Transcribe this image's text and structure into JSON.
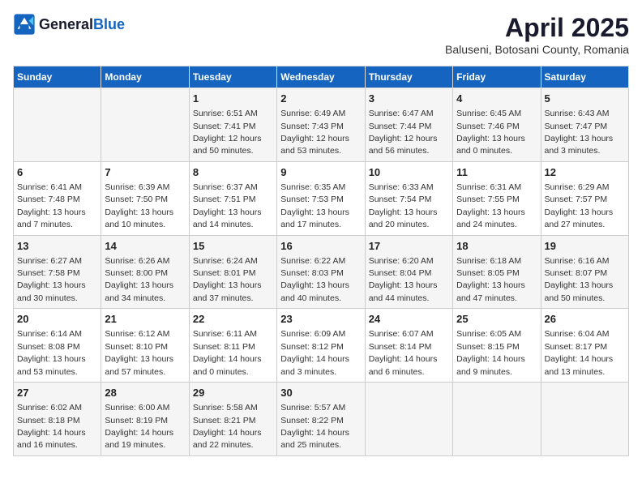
{
  "header": {
    "logo_general": "General",
    "logo_blue": "Blue",
    "title": "April 2025",
    "location": "Baluseni, Botosani County, Romania"
  },
  "days_of_week": [
    "Sunday",
    "Monday",
    "Tuesday",
    "Wednesday",
    "Thursday",
    "Friday",
    "Saturday"
  ],
  "weeks": [
    [
      {
        "day": "",
        "sunrise": "",
        "sunset": "",
        "daylight": ""
      },
      {
        "day": "",
        "sunrise": "",
        "sunset": "",
        "daylight": ""
      },
      {
        "day": "1",
        "sunrise": "Sunrise: 6:51 AM",
        "sunset": "Sunset: 7:41 PM",
        "daylight": "Daylight: 12 hours and 50 minutes."
      },
      {
        "day": "2",
        "sunrise": "Sunrise: 6:49 AM",
        "sunset": "Sunset: 7:43 PM",
        "daylight": "Daylight: 12 hours and 53 minutes."
      },
      {
        "day": "3",
        "sunrise": "Sunrise: 6:47 AM",
        "sunset": "Sunset: 7:44 PM",
        "daylight": "Daylight: 12 hours and 56 minutes."
      },
      {
        "day": "4",
        "sunrise": "Sunrise: 6:45 AM",
        "sunset": "Sunset: 7:46 PM",
        "daylight": "Daylight: 13 hours and 0 minutes."
      },
      {
        "day": "5",
        "sunrise": "Sunrise: 6:43 AM",
        "sunset": "Sunset: 7:47 PM",
        "daylight": "Daylight: 13 hours and 3 minutes."
      }
    ],
    [
      {
        "day": "6",
        "sunrise": "Sunrise: 6:41 AM",
        "sunset": "Sunset: 7:48 PM",
        "daylight": "Daylight: 13 hours and 7 minutes."
      },
      {
        "day": "7",
        "sunrise": "Sunrise: 6:39 AM",
        "sunset": "Sunset: 7:50 PM",
        "daylight": "Daylight: 13 hours and 10 minutes."
      },
      {
        "day": "8",
        "sunrise": "Sunrise: 6:37 AM",
        "sunset": "Sunset: 7:51 PM",
        "daylight": "Daylight: 13 hours and 14 minutes."
      },
      {
        "day": "9",
        "sunrise": "Sunrise: 6:35 AM",
        "sunset": "Sunset: 7:53 PM",
        "daylight": "Daylight: 13 hours and 17 minutes."
      },
      {
        "day": "10",
        "sunrise": "Sunrise: 6:33 AM",
        "sunset": "Sunset: 7:54 PM",
        "daylight": "Daylight: 13 hours and 20 minutes."
      },
      {
        "day": "11",
        "sunrise": "Sunrise: 6:31 AM",
        "sunset": "Sunset: 7:55 PM",
        "daylight": "Daylight: 13 hours and 24 minutes."
      },
      {
        "day": "12",
        "sunrise": "Sunrise: 6:29 AM",
        "sunset": "Sunset: 7:57 PM",
        "daylight": "Daylight: 13 hours and 27 minutes."
      }
    ],
    [
      {
        "day": "13",
        "sunrise": "Sunrise: 6:27 AM",
        "sunset": "Sunset: 7:58 PM",
        "daylight": "Daylight: 13 hours and 30 minutes."
      },
      {
        "day": "14",
        "sunrise": "Sunrise: 6:26 AM",
        "sunset": "Sunset: 8:00 PM",
        "daylight": "Daylight: 13 hours and 34 minutes."
      },
      {
        "day": "15",
        "sunrise": "Sunrise: 6:24 AM",
        "sunset": "Sunset: 8:01 PM",
        "daylight": "Daylight: 13 hours and 37 minutes."
      },
      {
        "day": "16",
        "sunrise": "Sunrise: 6:22 AM",
        "sunset": "Sunset: 8:03 PM",
        "daylight": "Daylight: 13 hours and 40 minutes."
      },
      {
        "day": "17",
        "sunrise": "Sunrise: 6:20 AM",
        "sunset": "Sunset: 8:04 PM",
        "daylight": "Daylight: 13 hours and 44 minutes."
      },
      {
        "day": "18",
        "sunrise": "Sunrise: 6:18 AM",
        "sunset": "Sunset: 8:05 PM",
        "daylight": "Daylight: 13 hours and 47 minutes."
      },
      {
        "day": "19",
        "sunrise": "Sunrise: 6:16 AM",
        "sunset": "Sunset: 8:07 PM",
        "daylight": "Daylight: 13 hours and 50 minutes."
      }
    ],
    [
      {
        "day": "20",
        "sunrise": "Sunrise: 6:14 AM",
        "sunset": "Sunset: 8:08 PM",
        "daylight": "Daylight: 13 hours and 53 minutes."
      },
      {
        "day": "21",
        "sunrise": "Sunrise: 6:12 AM",
        "sunset": "Sunset: 8:10 PM",
        "daylight": "Daylight: 13 hours and 57 minutes."
      },
      {
        "day": "22",
        "sunrise": "Sunrise: 6:11 AM",
        "sunset": "Sunset: 8:11 PM",
        "daylight": "Daylight: 14 hours and 0 minutes."
      },
      {
        "day": "23",
        "sunrise": "Sunrise: 6:09 AM",
        "sunset": "Sunset: 8:12 PM",
        "daylight": "Daylight: 14 hours and 3 minutes."
      },
      {
        "day": "24",
        "sunrise": "Sunrise: 6:07 AM",
        "sunset": "Sunset: 8:14 PM",
        "daylight": "Daylight: 14 hours and 6 minutes."
      },
      {
        "day": "25",
        "sunrise": "Sunrise: 6:05 AM",
        "sunset": "Sunset: 8:15 PM",
        "daylight": "Daylight: 14 hours and 9 minutes."
      },
      {
        "day": "26",
        "sunrise": "Sunrise: 6:04 AM",
        "sunset": "Sunset: 8:17 PM",
        "daylight": "Daylight: 14 hours and 13 minutes."
      }
    ],
    [
      {
        "day": "27",
        "sunrise": "Sunrise: 6:02 AM",
        "sunset": "Sunset: 8:18 PM",
        "daylight": "Daylight: 14 hours and 16 minutes."
      },
      {
        "day": "28",
        "sunrise": "Sunrise: 6:00 AM",
        "sunset": "Sunset: 8:19 PM",
        "daylight": "Daylight: 14 hours and 19 minutes."
      },
      {
        "day": "29",
        "sunrise": "Sunrise: 5:58 AM",
        "sunset": "Sunset: 8:21 PM",
        "daylight": "Daylight: 14 hours and 22 minutes."
      },
      {
        "day": "30",
        "sunrise": "Sunrise: 5:57 AM",
        "sunset": "Sunset: 8:22 PM",
        "daylight": "Daylight: 14 hours and 25 minutes."
      },
      {
        "day": "",
        "sunrise": "",
        "sunset": "",
        "daylight": ""
      },
      {
        "day": "",
        "sunrise": "",
        "sunset": "",
        "daylight": ""
      },
      {
        "day": "",
        "sunrise": "",
        "sunset": "",
        "daylight": ""
      }
    ]
  ]
}
